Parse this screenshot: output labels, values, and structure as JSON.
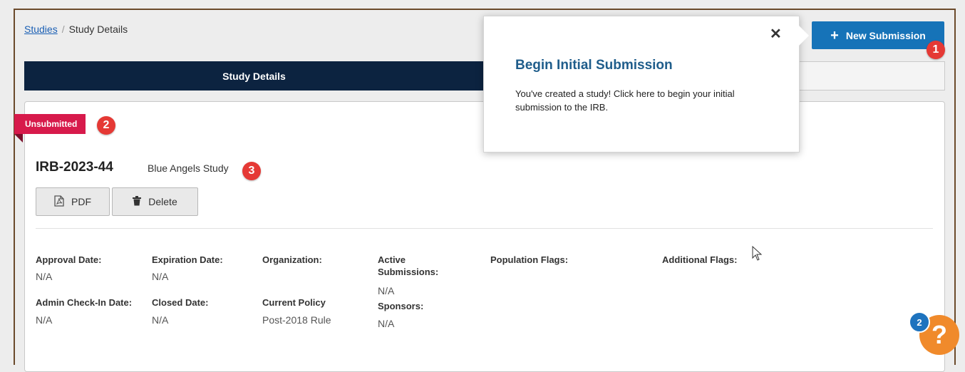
{
  "breadcrumb": {
    "root_link": "Studies",
    "separator": "/",
    "current": "Study Details"
  },
  "header": {
    "new_submission_label": "New Submission",
    "new_submission_badge": "1"
  },
  "tabs": [
    {
      "label": "Study Details",
      "active": true
    },
    {
      "label": "",
      "active": false
    }
  ],
  "study": {
    "status": "Unsubmitted",
    "status_badge": "2",
    "id": "IRB-2023-44",
    "name": "Blue Angels Study",
    "name_badge": "3",
    "pdf_label": "PDF",
    "delete_label": "Delete"
  },
  "details": {
    "approval_date": {
      "label": "Approval Date:",
      "value": "N/A"
    },
    "expiration_date": {
      "label": "Expiration Date:",
      "value": "N/A"
    },
    "organization": {
      "label": "Organization:",
      "value": ""
    },
    "active_submissions": {
      "label_line1": "Active",
      "label_line2": "Submissions:",
      "value": "N/A"
    },
    "population_flags": {
      "label": "Population Flags:",
      "value": ""
    },
    "additional_flags": {
      "label": "Additional Flags:",
      "value": ""
    },
    "admin_checkin_date": {
      "label": "Admin Check-In Date:",
      "value": "N/A"
    },
    "closed_date": {
      "label": "Closed Date:",
      "value": "N/A"
    },
    "current_policy": {
      "label": "Current Policy",
      "value": "Post-2018 Rule"
    },
    "sponsors": {
      "label": "Sponsors:",
      "value": "N/A"
    }
  },
  "popover": {
    "title": "Begin Initial Submission",
    "body": "You've created a study! Click here to begin your initial submission to the IRB.",
    "close_glyph": "✕"
  },
  "help": {
    "glyph": "?",
    "count": "2"
  },
  "colors": {
    "primary": "#1673b8",
    "nav_dark": "#0c2340",
    "status_red": "#d71a4b",
    "step_badge": "#e53935",
    "help_orange": "#f08a2b",
    "popover_title": "#1f5d8b"
  }
}
